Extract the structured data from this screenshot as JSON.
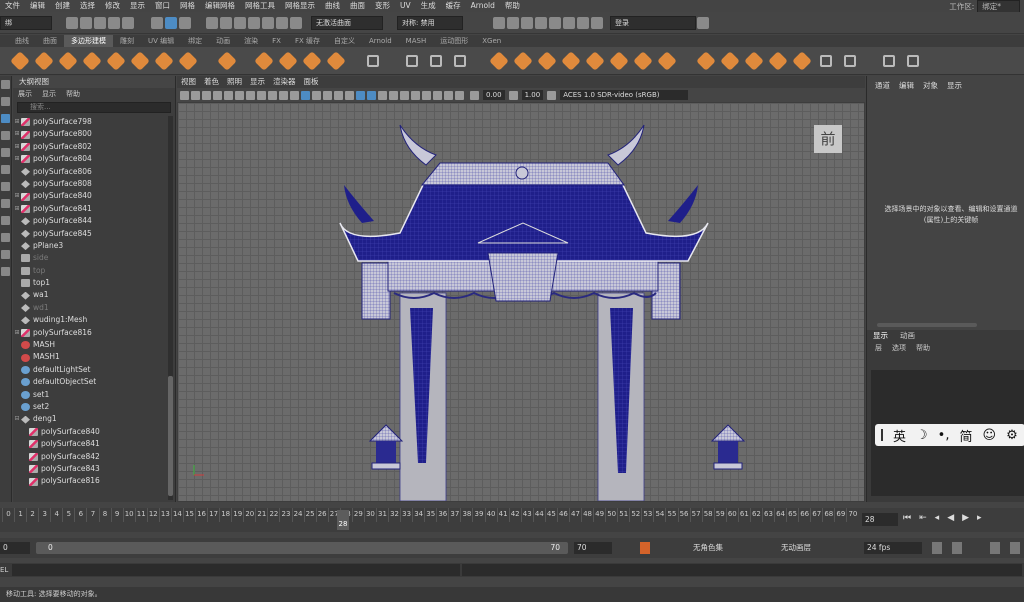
{
  "menubar": [
    "文件",
    "编辑",
    "创建",
    "选择",
    "修改",
    "显示",
    "窗口",
    "网格",
    "编辑网格",
    "网格工具",
    "网格显示",
    "曲线",
    "曲面",
    "变形",
    "UV",
    "生成",
    "缓存",
    "Arnold",
    "帮助"
  ],
  "workspace": {
    "label": "工作区:",
    "value": "绑定*"
  },
  "toolbar": {
    "mode": "绑",
    "live_surface": "无激活曲面",
    "symmetry": "对称: 禁用",
    "login": "登录"
  },
  "shelf_tabs": [
    "曲线",
    "曲面",
    "多边形建模",
    "雕刻",
    "UV 编辑",
    "绑定",
    "动画",
    "渲染",
    "FX",
    "FX 缓存",
    "自定义",
    "Arnold",
    "MASH",
    "运动图形",
    "XGen"
  ],
  "shelf_active": "多边形建模",
  "outliner": {
    "title": "大纲视图",
    "menu": [
      "展示",
      "显示",
      "帮助"
    ],
    "search_placeholder": "搜索...",
    "items": [
      {
        "ex": "⊞",
        "icon": "mesh",
        "label": "polySurface798"
      },
      {
        "ex": "⊞",
        "icon": "mesh",
        "label": "polySurface800"
      },
      {
        "ex": "⊞",
        "icon": "mesh",
        "label": "polySurface802"
      },
      {
        "ex": "⊞",
        "icon": "mesh",
        "label": "polySurface804"
      },
      {
        "ex": "",
        "icon": "tf",
        "label": "polySurface806"
      },
      {
        "ex": "",
        "icon": "tf",
        "label": "polySurface808"
      },
      {
        "ex": "⊞",
        "icon": "mesh",
        "label": "polySurface840"
      },
      {
        "ex": "⊞",
        "icon": "mesh",
        "label": "polySurface841"
      },
      {
        "ex": "",
        "icon": "tf",
        "label": "polySurface844"
      },
      {
        "ex": "",
        "icon": "tf",
        "label": "polySurface845"
      },
      {
        "ex": "",
        "icon": "tf",
        "label": "pPlane3"
      },
      {
        "ex": "",
        "icon": "cam",
        "label": "side",
        "dim": true
      },
      {
        "ex": "",
        "icon": "cam",
        "label": "top",
        "dim": true
      },
      {
        "ex": "",
        "icon": "cam",
        "label": "top1"
      },
      {
        "ex": "",
        "icon": "tf",
        "label": "wa1"
      },
      {
        "ex": "",
        "icon": "tf",
        "label": "wd1",
        "dim": true
      },
      {
        "ex": "",
        "icon": "tf",
        "label": "wuding1:Mesh"
      },
      {
        "ex": "⊞",
        "icon": "mesh",
        "label": "polySurface816"
      },
      {
        "ex": "",
        "icon": "mash",
        "label": "MASH"
      },
      {
        "ex": "",
        "icon": "mash",
        "label": "MASH1"
      },
      {
        "ex": "",
        "icon": "set",
        "label": "defaultLightSet"
      },
      {
        "ex": "",
        "icon": "set",
        "label": "defaultObjectSet"
      },
      {
        "ex": "",
        "icon": "set",
        "label": "set1"
      },
      {
        "ex": "",
        "icon": "set",
        "label": "set2"
      },
      {
        "ex": "⊟",
        "icon": "tf",
        "label": "deng1"
      },
      {
        "ex": "",
        "icon": "mesh",
        "label": "polySurface840",
        "indent": true
      },
      {
        "ex": "",
        "icon": "mesh",
        "label": "polySurface841",
        "indent": true
      },
      {
        "ex": "",
        "icon": "mesh",
        "label": "polySurface842",
        "indent": true
      },
      {
        "ex": "",
        "icon": "mesh",
        "label": "polySurface843",
        "indent": true
      },
      {
        "ex": "",
        "icon": "mesh",
        "label": "polySurface816",
        "indent": true
      }
    ]
  },
  "viewport": {
    "menu": [
      "视图",
      "着色",
      "照明",
      "显示",
      "渲染器",
      "面板"
    ],
    "val1": "0.00",
    "val2": "1.00",
    "colorspace": "ACES 1.0 SDR-video (sRGB)",
    "cube_label": "前"
  },
  "right": {
    "tabs": [
      "通道",
      "编辑",
      "对象",
      "显示"
    ],
    "message": "选择场景中的对象以查看、编辑和设置通道(属性)上的关键帧",
    "layer_tabs": [
      "显示",
      "动画"
    ],
    "layer_menu": [
      "层",
      "选项",
      "帮助"
    ],
    "ime": [
      "英",
      "☽",
      "•,",
      "简",
      "☺",
      "⚙"
    ]
  },
  "timeline": {
    "ticks": [
      "0",
      "1",
      "2",
      "3",
      "4",
      "5",
      "6",
      "7",
      "8",
      "9",
      "10",
      "11",
      "12",
      "13",
      "14",
      "15",
      "16",
      "17",
      "18",
      "19",
      "20",
      "21",
      "22",
      "23",
      "24",
      "25",
      "26",
      "27",
      "28",
      "29",
      "30",
      "31",
      "32",
      "33",
      "34",
      "35",
      "36",
      "37",
      "38",
      "39",
      "40",
      "41",
      "42",
      "43",
      "44",
      "45",
      "46",
      "47",
      "48",
      "49",
      "50",
      "51",
      "52",
      "53",
      "54",
      "55",
      "56",
      "57",
      "58",
      "59",
      "60",
      "61",
      "62",
      "63",
      "64",
      "65",
      "66",
      "67",
      "68",
      "69",
      "70"
    ],
    "current": "28",
    "frame_field": "28"
  },
  "range": {
    "start_outer": "0",
    "start": "0",
    "end": "70",
    "end_outer": "70",
    "char_set": "无角色集",
    "anim_layer": "无动画层",
    "fps": "24 fps"
  },
  "cmd": {
    "label": "EL"
  },
  "help_line": "移动工具: 选择要移动的对象。"
}
